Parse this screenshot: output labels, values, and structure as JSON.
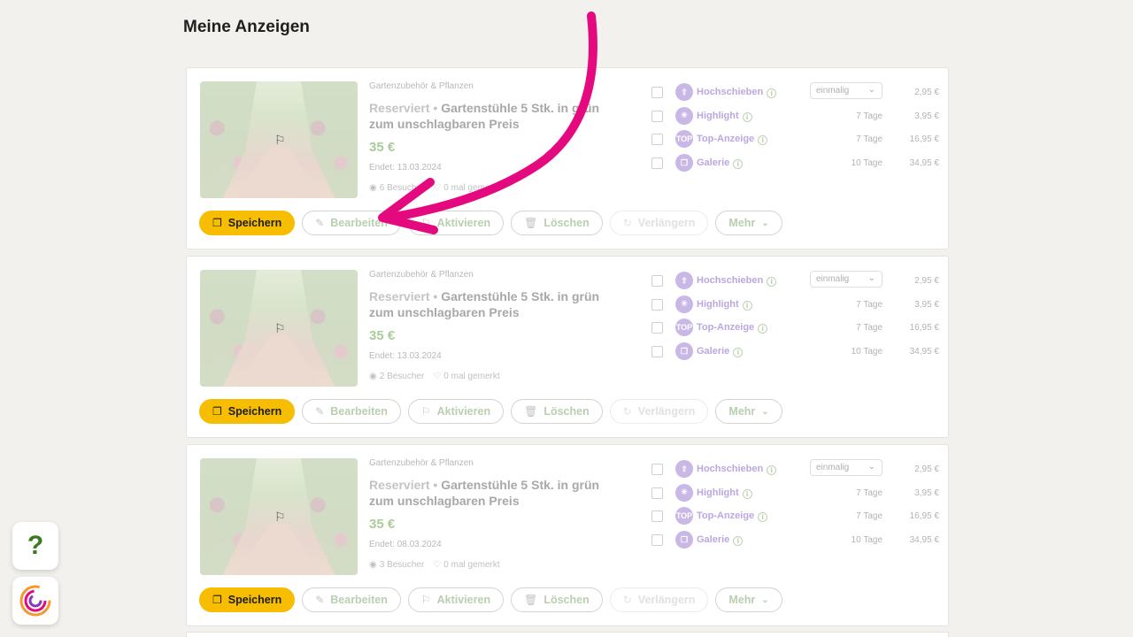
{
  "page": {
    "title": "Meine Anzeigen"
  },
  "listings": [
    {
      "category": "Gartenzubehör & Pflanzen",
      "status": "Reserviert",
      "separator": "•",
      "title": "Gartenstühle 5 Stk. in grün zum unschlagbaren Preis",
      "price": "35 €",
      "ends": "Endet: 13.03.2024",
      "visitors": "6 Besucher",
      "watchers": "0 mal gemerkt"
    },
    {
      "category": "Gartenzubehör & Pflanzen",
      "status": "Reserviert",
      "separator": "•",
      "title": "Gartenstühle 5 Stk. in grün zum unschlagbaren Preis",
      "price": "35 €",
      "ends": "Endet: 13.03.2024",
      "visitors": "2 Besucher",
      "watchers": "0 mal gemerkt"
    },
    {
      "category": "Gartenzubehör & Pflanzen",
      "status": "Reserviert",
      "separator": "•",
      "title": "Gartenstühle 5 Stk. in grün zum unschlagbaren Preis",
      "price": "35 €",
      "ends": "Endet: 08.03.2024",
      "visitors": "3 Besucher",
      "watchers": "0 mal gemerkt"
    }
  ],
  "promotions": [
    {
      "name": "Hochschieben",
      "icon": "arrow-up-icon",
      "glyph": "⇧",
      "duration": "einmalig",
      "price": "2,95 €"
    },
    {
      "name": "Highlight",
      "icon": "sparkle-icon",
      "glyph": "✳",
      "duration": "7 Tage",
      "price": "3,95 €"
    },
    {
      "name": "Top-Anzeige",
      "icon": "top-badge-icon",
      "glyph": "TOP",
      "duration": "7 Tage",
      "price": "16,95 €"
    },
    {
      "name": "Galerie",
      "icon": "gallery-icon",
      "glyph": "❐",
      "duration": "10 Tage",
      "price": "34,95 €"
    }
  ],
  "actions": {
    "save": "Speichern",
    "edit": "Bearbeiten",
    "activate": "Aktivieren",
    "delete": "Löschen",
    "extend": "Verlängern",
    "more": "Mehr"
  },
  "floating": {
    "help": "?"
  },
  "colors": {
    "accent": "#f7bd00",
    "price": "#a9cc9a",
    "promo": "#bba8e0",
    "arrow": "#e5097f"
  }
}
